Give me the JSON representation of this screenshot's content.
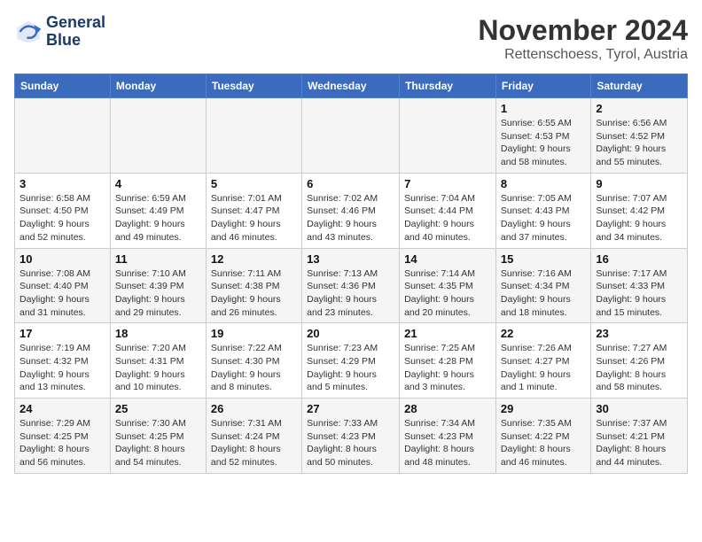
{
  "header": {
    "logo_line1": "General",
    "logo_line2": "Blue",
    "month": "November 2024",
    "location": "Rettenschoess, Tyrol, Austria"
  },
  "columns": [
    "Sunday",
    "Monday",
    "Tuesday",
    "Wednesday",
    "Thursday",
    "Friday",
    "Saturday"
  ],
  "weeks": [
    [
      {
        "day": "",
        "detail": ""
      },
      {
        "day": "",
        "detail": ""
      },
      {
        "day": "",
        "detail": ""
      },
      {
        "day": "",
        "detail": ""
      },
      {
        "day": "",
        "detail": ""
      },
      {
        "day": "1",
        "detail": "Sunrise: 6:55 AM\nSunset: 4:53 PM\nDaylight: 9 hours and 58 minutes."
      },
      {
        "day": "2",
        "detail": "Sunrise: 6:56 AM\nSunset: 4:52 PM\nDaylight: 9 hours and 55 minutes."
      }
    ],
    [
      {
        "day": "3",
        "detail": "Sunrise: 6:58 AM\nSunset: 4:50 PM\nDaylight: 9 hours and 52 minutes."
      },
      {
        "day": "4",
        "detail": "Sunrise: 6:59 AM\nSunset: 4:49 PM\nDaylight: 9 hours and 49 minutes."
      },
      {
        "day": "5",
        "detail": "Sunrise: 7:01 AM\nSunset: 4:47 PM\nDaylight: 9 hours and 46 minutes."
      },
      {
        "day": "6",
        "detail": "Sunrise: 7:02 AM\nSunset: 4:46 PM\nDaylight: 9 hours and 43 minutes."
      },
      {
        "day": "7",
        "detail": "Sunrise: 7:04 AM\nSunset: 4:44 PM\nDaylight: 9 hours and 40 minutes."
      },
      {
        "day": "8",
        "detail": "Sunrise: 7:05 AM\nSunset: 4:43 PM\nDaylight: 9 hours and 37 minutes."
      },
      {
        "day": "9",
        "detail": "Sunrise: 7:07 AM\nSunset: 4:42 PM\nDaylight: 9 hours and 34 minutes."
      }
    ],
    [
      {
        "day": "10",
        "detail": "Sunrise: 7:08 AM\nSunset: 4:40 PM\nDaylight: 9 hours and 31 minutes."
      },
      {
        "day": "11",
        "detail": "Sunrise: 7:10 AM\nSunset: 4:39 PM\nDaylight: 9 hours and 29 minutes."
      },
      {
        "day": "12",
        "detail": "Sunrise: 7:11 AM\nSunset: 4:38 PM\nDaylight: 9 hours and 26 minutes."
      },
      {
        "day": "13",
        "detail": "Sunrise: 7:13 AM\nSunset: 4:36 PM\nDaylight: 9 hours and 23 minutes."
      },
      {
        "day": "14",
        "detail": "Sunrise: 7:14 AM\nSunset: 4:35 PM\nDaylight: 9 hours and 20 minutes."
      },
      {
        "day": "15",
        "detail": "Sunrise: 7:16 AM\nSunset: 4:34 PM\nDaylight: 9 hours and 18 minutes."
      },
      {
        "day": "16",
        "detail": "Sunrise: 7:17 AM\nSunset: 4:33 PM\nDaylight: 9 hours and 15 minutes."
      }
    ],
    [
      {
        "day": "17",
        "detail": "Sunrise: 7:19 AM\nSunset: 4:32 PM\nDaylight: 9 hours and 13 minutes."
      },
      {
        "day": "18",
        "detail": "Sunrise: 7:20 AM\nSunset: 4:31 PM\nDaylight: 9 hours and 10 minutes."
      },
      {
        "day": "19",
        "detail": "Sunrise: 7:22 AM\nSunset: 4:30 PM\nDaylight: 9 hours and 8 minutes."
      },
      {
        "day": "20",
        "detail": "Sunrise: 7:23 AM\nSunset: 4:29 PM\nDaylight: 9 hours and 5 minutes."
      },
      {
        "day": "21",
        "detail": "Sunrise: 7:25 AM\nSunset: 4:28 PM\nDaylight: 9 hours and 3 minutes."
      },
      {
        "day": "22",
        "detail": "Sunrise: 7:26 AM\nSunset: 4:27 PM\nDaylight: 9 hours and 1 minute."
      },
      {
        "day": "23",
        "detail": "Sunrise: 7:27 AM\nSunset: 4:26 PM\nDaylight: 8 hours and 58 minutes."
      }
    ],
    [
      {
        "day": "24",
        "detail": "Sunrise: 7:29 AM\nSunset: 4:25 PM\nDaylight: 8 hours and 56 minutes."
      },
      {
        "day": "25",
        "detail": "Sunrise: 7:30 AM\nSunset: 4:25 PM\nDaylight: 8 hours and 54 minutes."
      },
      {
        "day": "26",
        "detail": "Sunrise: 7:31 AM\nSunset: 4:24 PM\nDaylight: 8 hours and 52 minutes."
      },
      {
        "day": "27",
        "detail": "Sunrise: 7:33 AM\nSunset: 4:23 PM\nDaylight: 8 hours and 50 minutes."
      },
      {
        "day": "28",
        "detail": "Sunrise: 7:34 AM\nSunset: 4:23 PM\nDaylight: 8 hours and 48 minutes."
      },
      {
        "day": "29",
        "detail": "Sunrise: 7:35 AM\nSunset: 4:22 PM\nDaylight: 8 hours and 46 minutes."
      },
      {
        "day": "30",
        "detail": "Sunrise: 7:37 AM\nSunset: 4:21 PM\nDaylight: 8 hours and 44 minutes."
      }
    ]
  ]
}
